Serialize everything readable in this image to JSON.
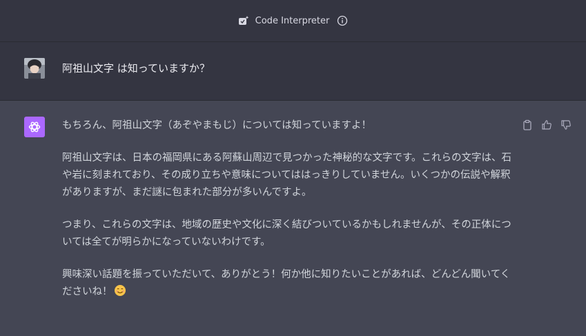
{
  "header": {
    "mode_label": "Code Interpreter",
    "mode_icon": "code-interpreter-icon",
    "info_icon": "info-icon"
  },
  "conversation": {
    "user_message": "阿祖山文字 は知っていますか？",
    "assistant_paragraphs": [
      "もちろん、阿祖山文字（あぞやまもじ）については知っていますよ！",
      "阿祖山文字は、日本の福岡県にある阿蘇山周辺で見つかった神秘的な文字です。これらの文字は、石や岩に刻まれており、その成り立ちや意味についてははっきりしていません。いくつかの伝説や解釈がありますが、まだ謎に包まれた部分が多いんですよ。",
      "つまり、これらの文字は、地域の歴史や文化に深く結びついているかもしれませんが、その正体については全てが明らかになっていないわけです。",
      "興味深い話題を振っていただいて、ありがとう！何か他に知りたいことがあれば、どんどん聞いてくださいね！"
    ],
    "emoji": "smiling-face-emoji"
  },
  "actions": {
    "copy_icon": "clipboard-icon",
    "like_icon": "thumbs-up-icon",
    "dislike_icon": "thumbs-down-icon"
  },
  "colors": {
    "header_bg": "#343541",
    "assistant_bg": "#444654",
    "gpt_avatar": "#ab68ff"
  }
}
